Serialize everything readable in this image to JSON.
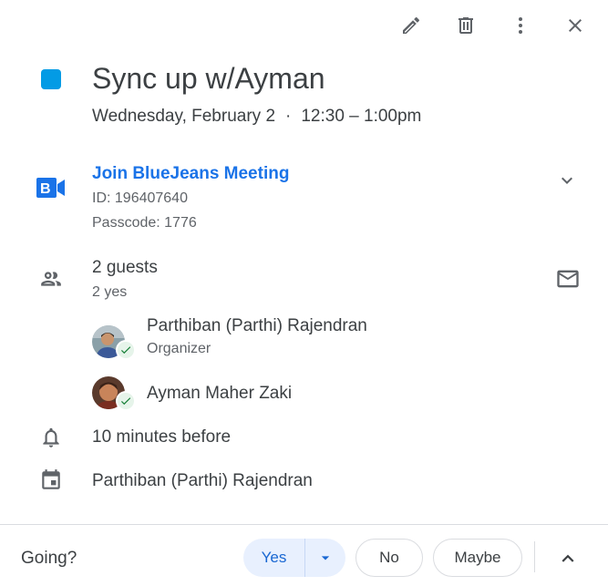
{
  "toolbar": {
    "edit_icon": "pencil-icon",
    "delete_icon": "trash-icon",
    "more_icon": "more-vert-icon",
    "close_icon": "close-icon"
  },
  "event": {
    "color": "#039be5",
    "title": "Sync up w/Ayman",
    "date": "Wednesday, February 2",
    "separator": "·",
    "time": "12:30 – 1:00pm"
  },
  "conference": {
    "provider_icon": "bluejeans-logo",
    "join_label": "Join BlueJeans Meeting",
    "id_text": "ID: 196407640",
    "passcode_text": "Passcode: 1776"
  },
  "guests": {
    "count_label": "2 guests",
    "summary": "2 yes",
    "list": [
      {
        "name": "Parthiban (Parthi) Rajendran",
        "role": "Organizer",
        "status": "accepted"
      },
      {
        "name": "Ayman Maher Zaki",
        "role": "",
        "status": "accepted"
      }
    ]
  },
  "reminder": {
    "text": "10 minutes before"
  },
  "calendar": {
    "owner": "Parthiban (Parthi) Rajendran"
  },
  "rsvp": {
    "label": "Going?",
    "yes": "Yes",
    "no": "No",
    "maybe": "Maybe",
    "accent": "#1967d2",
    "accent_bg": "#e8f0fe"
  }
}
